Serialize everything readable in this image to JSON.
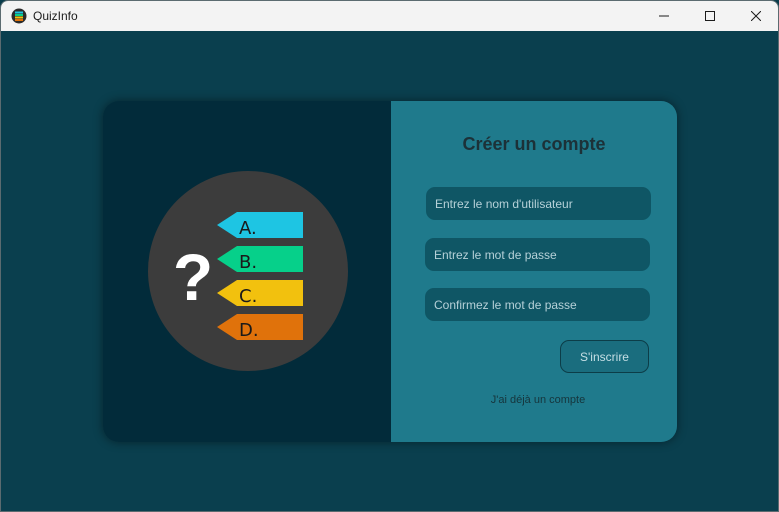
{
  "window": {
    "title": "QuizInfo",
    "icons": {
      "app": "quizinfo-app-icon",
      "minimize": "minimize-icon",
      "maximize": "maximize-icon",
      "close": "close-icon"
    }
  },
  "colors": {
    "background": "#0a3f4e",
    "left_panel": "#022b3a",
    "right_panel": "#1f7a8c",
    "field": "#0f5665",
    "circle": "#3c3c3c",
    "option_a": "#1ec5e3",
    "option_b": "#06d08a",
    "option_c": "#f2c10e",
    "option_d": "#e0720b"
  },
  "logo": {
    "icon": "quiz-question-logo",
    "question_mark": "?",
    "options": [
      "A.",
      "B.",
      "C.",
      "D."
    ]
  },
  "form": {
    "title": "Créer un compte",
    "username_placeholder": "Entrez le nom d'utilisateur",
    "password_placeholder": "Entrez le mot de passe",
    "confirm_placeholder": "Confirmez le mot de passe",
    "submit_label": "S'inscrire",
    "login_link": "J'ai déjà un compte"
  }
}
